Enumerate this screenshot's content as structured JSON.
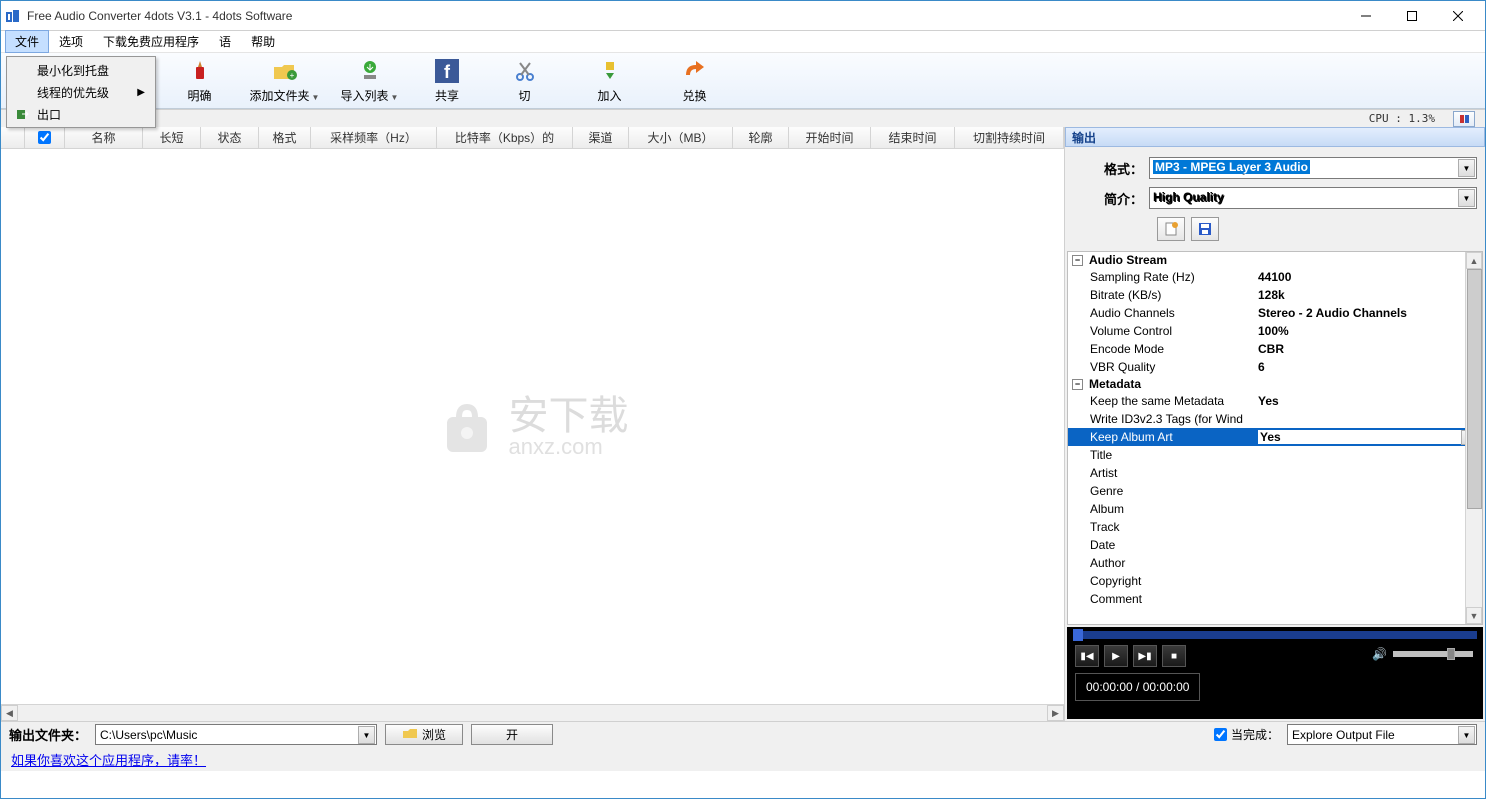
{
  "titlebar": {
    "title": "Free Audio Converter 4dots V3.1 - 4dots Software"
  },
  "menubar": {
    "file": "文件",
    "options": "选项",
    "download": "下载免费应用程序",
    "lang": "语",
    "help": "帮助"
  },
  "dropdown": {
    "min_tray": "最小化到托盘",
    "priority": "线程的优先级",
    "exit": "出口"
  },
  "toolbar": {
    "clear": "明确",
    "add_folder": "添加文件夹",
    "import_list": "导入列表",
    "share": "共享",
    "cut": "切",
    "join": "加入",
    "convert": "兑换"
  },
  "cpu": {
    "text": "CPU : 1.3%"
  },
  "table_headers": {
    "check": "",
    "name": "名称",
    "length": "长短",
    "status": "状态",
    "format": "格式",
    "sample_rate": "采样频率（Hz）",
    "bitrate": "比特率（Kbps）的",
    "channels": "渠道",
    "size": "大小（MB）",
    "profile": "轮廓",
    "start": "开始时间",
    "end": "结束时间",
    "cut_duration": "切割持续时间"
  },
  "watermark": {
    "text": "安下载",
    "url": "anxz.com"
  },
  "output": {
    "header": "输出",
    "format_label": "格式：",
    "format_value": "MP3 - MPEG Layer 3 Audio",
    "profile_label": "简介：",
    "profile_value": "High Quality"
  },
  "props": {
    "audio_stream": "Audio Stream",
    "sampling_rate": {
      "k": "Sampling Rate (Hz)",
      "v": "44100"
    },
    "bitrate": {
      "k": "Bitrate (KB/s)",
      "v": "128k"
    },
    "channels": {
      "k": "Audio Channels",
      "v": "Stereo - 2 Audio Channels"
    },
    "volume": {
      "k": "Volume Control",
      "v": "100%"
    },
    "encode": {
      "k": "Encode Mode",
      "v": "CBR"
    },
    "vbr": {
      "k": "VBR Quality",
      "v": "6"
    },
    "metadata": "Metadata",
    "keep_meta": {
      "k": "Keep the same Metadata",
      "v": "Yes"
    },
    "id3": {
      "k": "Write ID3v2.3 Tags (for Wind",
      "v": ""
    },
    "album_art": {
      "k": "Keep Album Art",
      "v": "Yes"
    },
    "title": {
      "k": "Title",
      "v": ""
    },
    "artist": {
      "k": "Artist",
      "v": ""
    },
    "genre": {
      "k": "Genre",
      "v": ""
    },
    "album": {
      "k": "Album",
      "v": ""
    },
    "track": {
      "k": "Track",
      "v": ""
    },
    "date": {
      "k": "Date",
      "v": ""
    },
    "author": {
      "k": "Author",
      "v": ""
    },
    "copyright": {
      "k": "Copyright",
      "v": ""
    },
    "comment": {
      "k": "Comment",
      "v": ""
    }
  },
  "player": {
    "time": "00:00:00 / 00:00:00"
  },
  "bottom": {
    "out_folder_label": "输出文件夹：",
    "out_folder": "C:\\Users\\pc\\Music",
    "browse": "浏览",
    "open": "开",
    "when_done_label": "当完成：",
    "when_done": "Explore Output File"
  },
  "link": {
    "text": "如果你喜欢这个应用程序，请率！"
  }
}
